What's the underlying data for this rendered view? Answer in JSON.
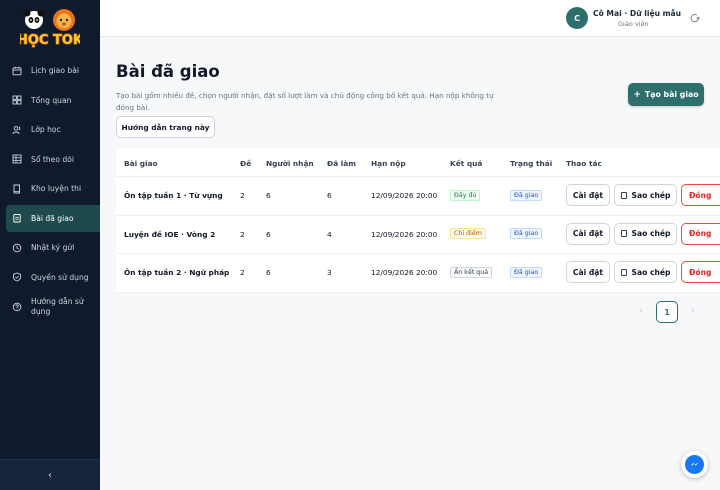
{
  "brand": {
    "logo_text": "HỌC TOK"
  },
  "sidebar": {
    "items": [
      {
        "label": "Lịch giao bài",
        "icon": "calendar-icon"
      },
      {
        "label": "Tổng quan",
        "icon": "grid-icon"
      },
      {
        "label": "Lớp học",
        "icon": "users-icon"
      },
      {
        "label": "Sổ theo dõi",
        "icon": "table-icon"
      },
      {
        "label": "Kho luyện thi",
        "icon": "book-icon"
      },
      {
        "label": "Bài đã giao",
        "icon": "clipboard-icon",
        "active": true
      },
      {
        "label": "Nhật ký gửi",
        "icon": "history-icon"
      },
      {
        "label": "Quyền sử dụng",
        "icon": "shield-icon"
      },
      {
        "label": "Hướng dẫn sử dụng",
        "icon": "help-icon"
      }
    ],
    "collapse_glyph": "‹"
  },
  "topbar": {
    "avatar_initial": "C",
    "user_name": "Cô Mai · Dữ liệu mẫu",
    "user_role": "Giáo viên"
  },
  "page": {
    "title": "Bài đã giao",
    "description": "Tạo bài gồm nhiều đề, chọn người nhận, đặt số lượt làm và chủ động công bố kết quả. Hạn nộp không tự đóng bài.",
    "guide_button": "Hướng dẫn trang này",
    "create_button": "Tạo bài giao"
  },
  "table": {
    "headers": [
      "Bài giao",
      "Đề",
      "Người nhận",
      "Đã làm",
      "Hạn nộp",
      "Kết quả",
      "Trạng thái",
      "Thao tác"
    ],
    "rows": [
      {
        "name": "Ôn tập tuần 1 · Từ vựng",
        "de": "2",
        "recipients": "6",
        "done": "6",
        "deadline": "12/09/2026 20:00",
        "result": "Đầy đủ",
        "status": "Đã giao"
      },
      {
        "name": "Luyện đề IOE · Vòng 2",
        "de": "2",
        "recipients": "6",
        "done": "4",
        "deadline": "12/09/2026 20:00",
        "result": "Chỉ điểm",
        "status": "Đã giao"
      },
      {
        "name": "Ôn tập tuần 2 · Ngữ pháp",
        "de": "2",
        "recipients": "6",
        "done": "3",
        "deadline": "12/09/2026 20:00",
        "result": "Ẩn kết quả",
        "status": "Đã giao"
      }
    ],
    "actions": {
      "settings": "Cài đặt",
      "copy": "Sao chép",
      "close": "Đóng"
    }
  },
  "pagination": {
    "prev": "‹",
    "current": "1",
    "next": "›"
  },
  "colors": {
    "sidebar_bg": "#0f1b2d",
    "accent": "#2f6f6b",
    "danger": "#dc2626"
  }
}
